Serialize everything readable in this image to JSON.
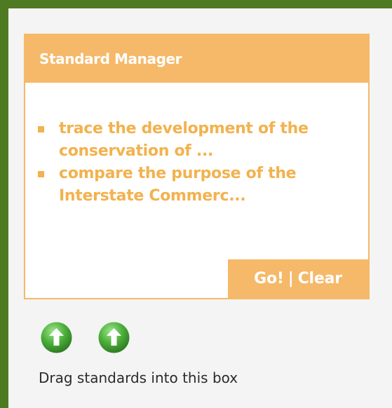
{
  "manager": {
    "title": "Standard Manager",
    "standards": [
      "trace the development of the conservation of ...",
      "compare the purpose of the Interstate Commerc..."
    ],
    "go_label": "Go!",
    "separator": "|",
    "clear_label": "Clear"
  },
  "arrows": [
    {
      "icon": "up-arrow-icon"
    },
    {
      "icon": "up-arrow-icon"
    }
  ],
  "hint": "Drag standards into this box",
  "colors": {
    "frame_green": "#4e7a22",
    "accent_orange": "#f5b969",
    "text_orange": "#f2b24e",
    "arrow_green": "#4caf3a"
  }
}
